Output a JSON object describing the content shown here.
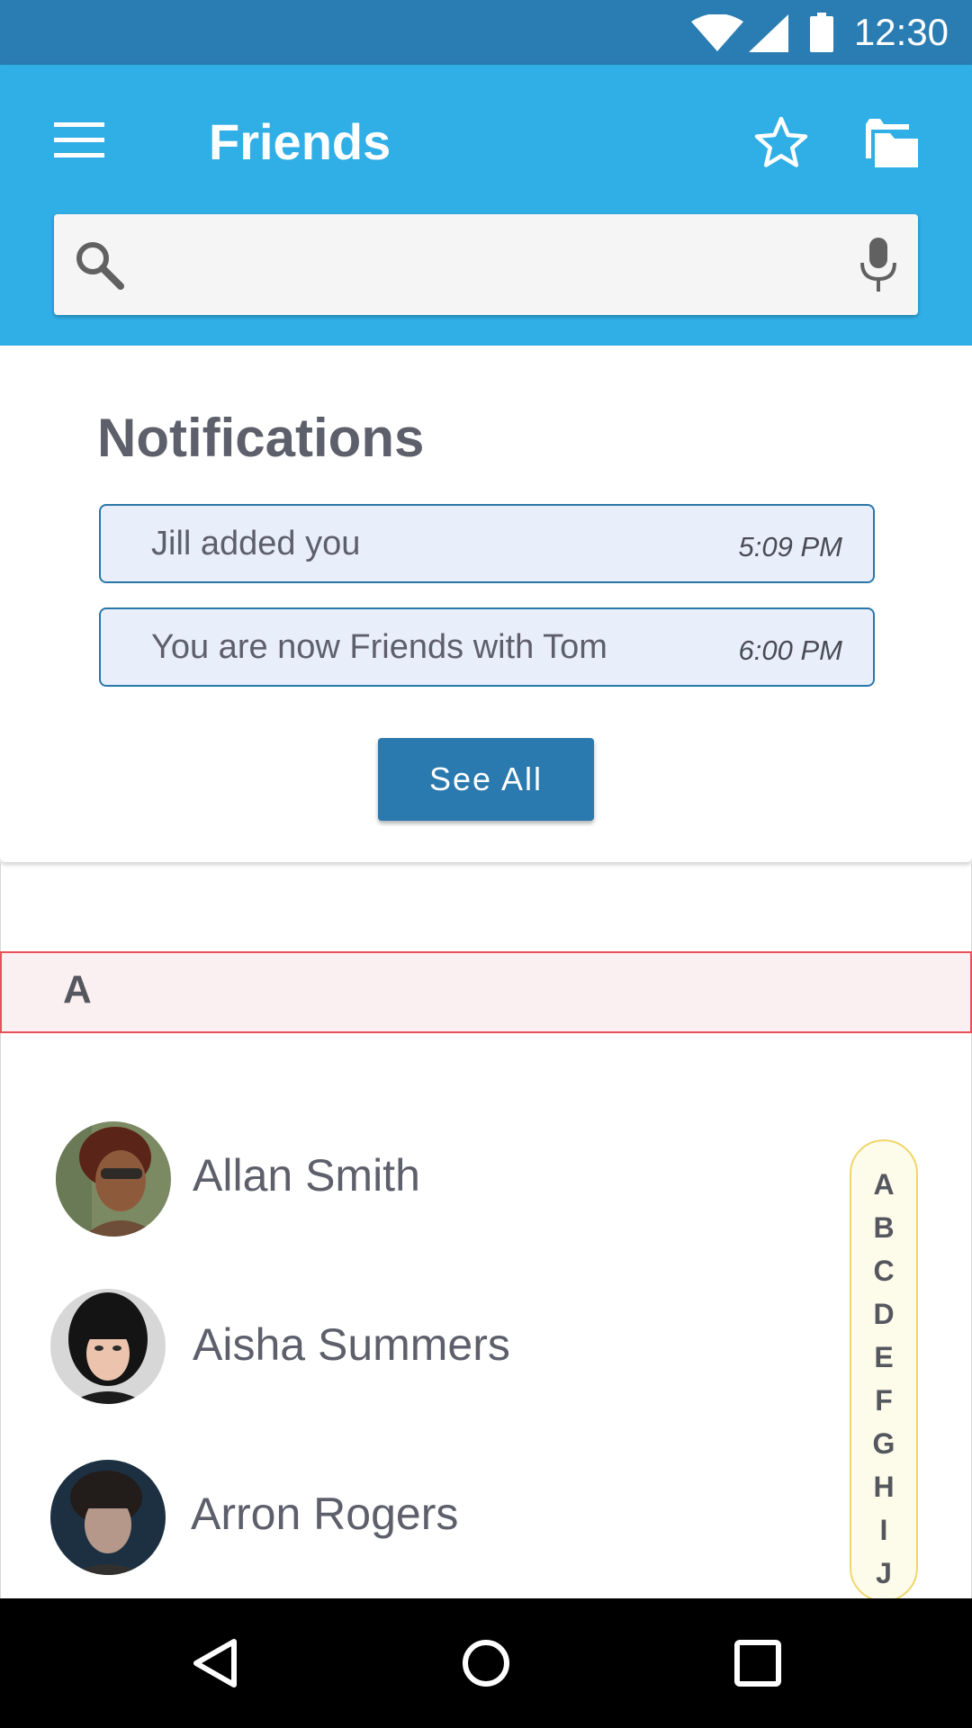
{
  "status_bar": {
    "time": "12:30"
  },
  "app_bar": {
    "title": "Friends",
    "menu_icon": "menu-icon",
    "favorite_icon": "star-icon",
    "folder_icon": "folder-icon"
  },
  "search": {
    "value": "",
    "placeholder": "",
    "search_icon": "search-icon",
    "mic_icon": "mic-icon"
  },
  "notifications": {
    "title": "Notifications",
    "items": [
      {
        "text": "Jill added you",
        "time": "5:09 PM"
      },
      {
        "text": "You are now Friends with Tom",
        "time": "6:00 PM"
      }
    ],
    "see_all_label": "See All"
  },
  "contacts": {
    "section_letter": "A",
    "items": [
      {
        "name": "Allan Smith"
      },
      {
        "name": "Aisha Summers"
      },
      {
        "name": "Arron Rogers"
      }
    ]
  },
  "alphabet_index": [
    "A",
    "B",
    "C",
    "D",
    "E",
    "F",
    "G",
    "H",
    "I",
    "J"
  ],
  "colors": {
    "status_bar": "#2a7db2",
    "app_bar": "#30aee6",
    "primary_button": "#2a79af",
    "notif_bg": "#e9eefb",
    "section_border": "#e8505a",
    "index_border": "#f0d66a"
  }
}
